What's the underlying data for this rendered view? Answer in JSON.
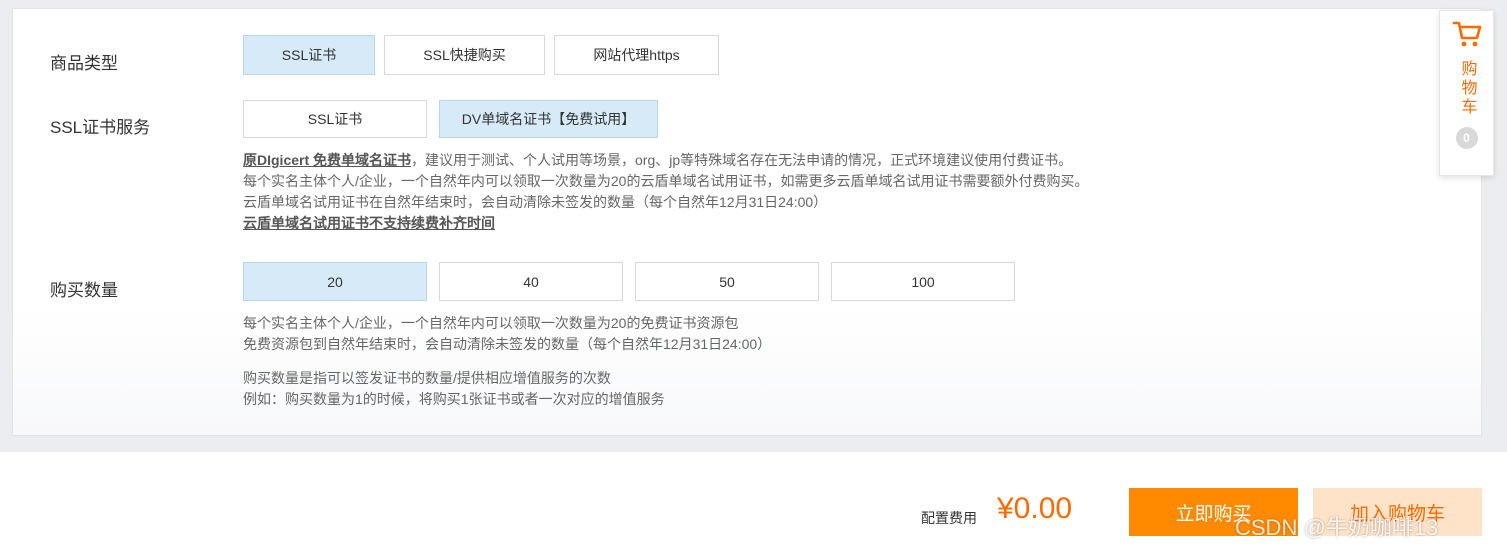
{
  "product_type": {
    "label": "商品类型",
    "options": [
      "SSL证书",
      "SSL快捷购买",
      "网站代理https"
    ],
    "selected": "SSL证书"
  },
  "ssl_service": {
    "label": "SSL证书服务",
    "options": [
      "SSL证书",
      "DV单域名证书【免费试用】"
    ],
    "selected": "DV单域名证书【免费试用】",
    "desc_bold": "原DIgicert 免费单域名证书",
    "desc_line1_rest": "，建议用于测试、个人试用等场景，org、jp等特殊域名存在无法申请的情况，正式环境建议使用付费证书。",
    "desc_line2": "每个实名主体个人/企业，一个自然年内可以领取一次数量为20的云盾单域名试用证书，如需更多云盾单域名试用证书需要额外付费购买。",
    "desc_line3": "云盾单域名试用证书在自然年结束时，会自动清除未签发的数量（每个自然年12月31日24:00）",
    "desc_line4_bold": "云盾单域名试用证书不支持续费补齐时间"
  },
  "quantity": {
    "label": "购买数量",
    "options": [
      "20",
      "40",
      "50",
      "100"
    ],
    "selected": "20",
    "desc_line1": "每个实名主体个人/企业，一个自然年内可以领取一次数量为20的免费证书资源包",
    "desc_line2": "免费资源包到自然年结束时，会自动清除未签发的数量（每个自然年12月31日24:00）",
    "desc_line3": "购买数量是指可以签发证书的数量/提供相应增值服务的次数",
    "desc_line4": "例如：购买数量为1的时候，将购买1张证书或者一次对应的增值服务"
  },
  "cart": {
    "label": "购物车",
    "count": "0",
    "icon": "shopping-cart-icon"
  },
  "footer": {
    "fee_label": "配置费用",
    "fee_value": "¥0.00",
    "buy_now": "立即购买",
    "add_to_cart": "加入购物车"
  },
  "watermark": "CSDN @牛奶咖啡13",
  "colors": {
    "accent": "#ff6a00",
    "buy_button": "#ff8a00",
    "selected_option": "#d7eaf8"
  }
}
